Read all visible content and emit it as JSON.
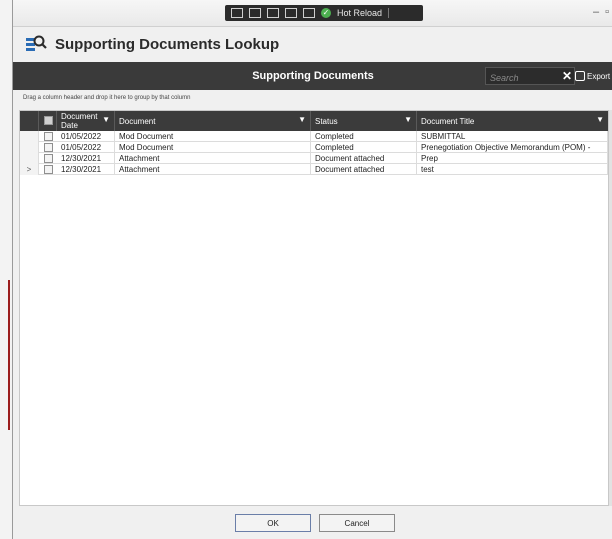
{
  "devbar": {
    "hot_reload_label": "Hot Reload"
  },
  "app": {
    "title": "Supporting Documents Lookup"
  },
  "banner": {
    "title": "Supporting Documents"
  },
  "search": {
    "placeholder": "Search",
    "clear_glyph": "✕"
  },
  "export": {
    "label": "Export"
  },
  "groupbar": {
    "hint": "Drag a column header and drop it here to group by that column"
  },
  "grid": {
    "columns": [
      {
        "label": "Document Date"
      },
      {
        "label": "Document"
      },
      {
        "label": "Status"
      },
      {
        "label": "Document Title"
      }
    ],
    "rows": [
      {
        "date": "01/05/2022",
        "document": "Mod Document",
        "status": "Completed",
        "title": "SUBMITTAL",
        "current": false
      },
      {
        "date": "01/05/2022",
        "document": "Mod Document",
        "status": "Completed",
        "title": "Prenegotiation Objective Memorandum (POM) -",
        "current": false
      },
      {
        "date": "12/30/2021",
        "document": "Attachment",
        "status": "Document attached",
        "title": "Prep",
        "current": false
      },
      {
        "date": "12/30/2021",
        "document": "Attachment",
        "status": "Document attached",
        "title": "test",
        "current": true
      }
    ],
    "current_row_glyph": ">"
  },
  "footer": {
    "ok_label": "OK",
    "cancel_label": "Cancel"
  },
  "icons": {
    "app": "lookup-grid-icon",
    "filter": "filter-funnel-icon",
    "export": "export-icon",
    "hot_reload": "hot-reload-check-icon"
  },
  "colors": {
    "banner_bg": "#3a3a3a",
    "header_bg": "#3b3b3b",
    "hot_reload": "#4caf50",
    "app_icon": "#2a6cb5"
  }
}
